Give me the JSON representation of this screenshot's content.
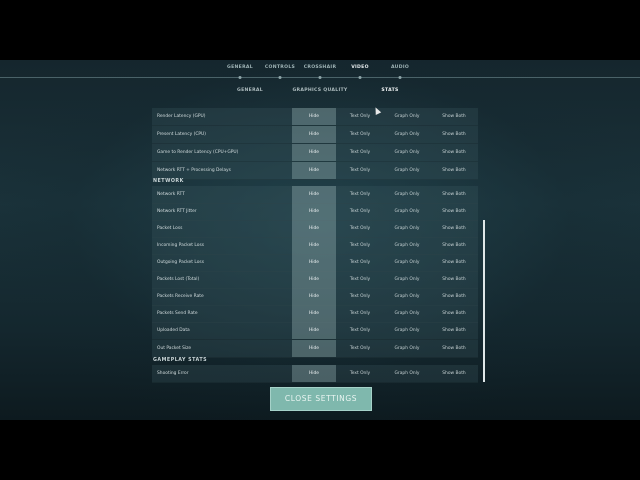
{
  "nav": {
    "tabs": [
      {
        "label": "GENERAL"
      },
      {
        "label": "CONTROLS"
      },
      {
        "label": "CROSSHAIR"
      },
      {
        "label": "VIDEO"
      },
      {
        "label": "AUDIO"
      }
    ],
    "subtabs": [
      {
        "label": "GENERAL"
      },
      {
        "label": "GRAPHICS QUALITY"
      },
      {
        "label": "STATS"
      }
    ]
  },
  "options": {
    "hide": "Hide",
    "text": "Text Only",
    "graph": "Graph Only",
    "both": "Show Both"
  },
  "sections": {
    "latency": {
      "rows": [
        {
          "label": "Render Latency (GPU)"
        },
        {
          "label": "Present Latency (CPU)"
        },
        {
          "label": "Game to Render Latency (CPU+GPU)"
        },
        {
          "label": "Network RTT + Processing Delays"
        }
      ]
    },
    "network": {
      "title": "NETWORK",
      "rows": [
        {
          "label": "Network RTT"
        },
        {
          "label": "Network RTT Jitter"
        },
        {
          "label": "Packet Loss"
        },
        {
          "label": "Incoming Packet Loss"
        },
        {
          "label": "Outgoing Packet Loss"
        },
        {
          "label": "Packets Lost (Total)"
        },
        {
          "label": "Packets Receive Rate"
        },
        {
          "label": "Packets Send Rate"
        },
        {
          "label": "Uploaded Data"
        },
        {
          "label": "Out Packet Size"
        }
      ]
    },
    "gameplay": {
      "title": "GAMEPLAY STATS",
      "rows": [
        {
          "label": "Shooting Error"
        }
      ]
    }
  },
  "close_label": "CLOSE SETTINGS"
}
